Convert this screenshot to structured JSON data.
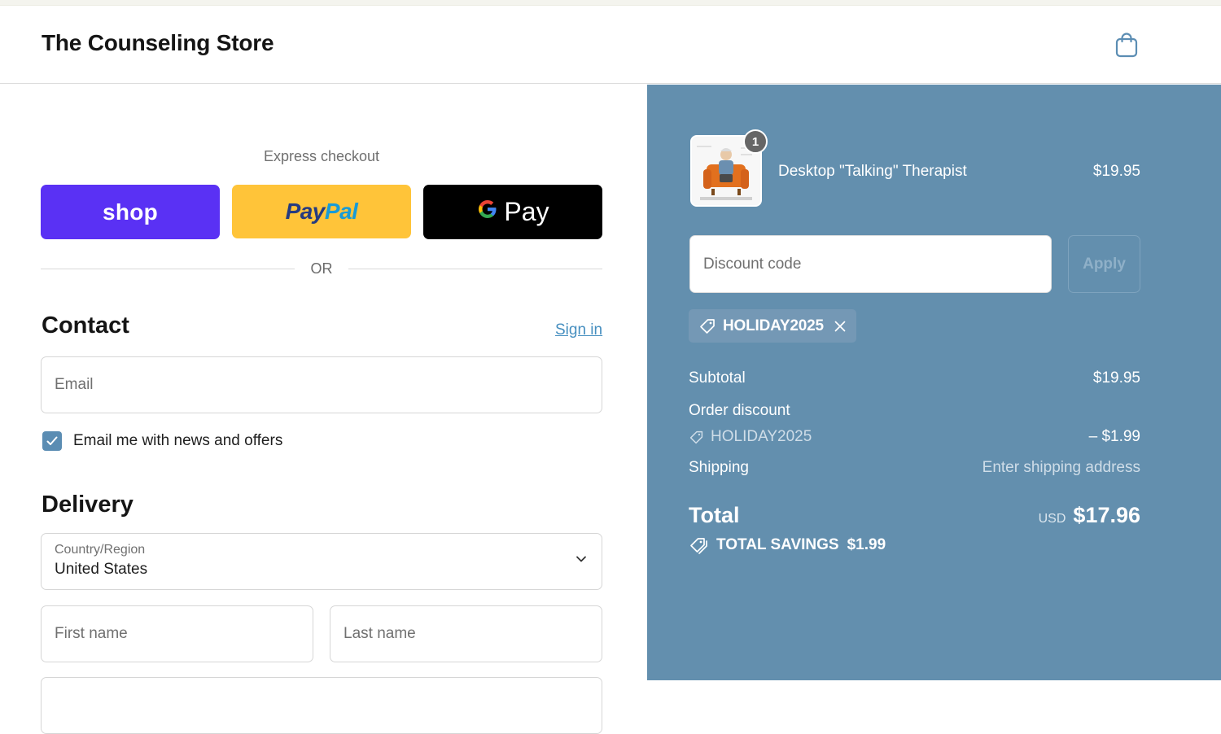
{
  "header": {
    "store_name": "The Counseling Store",
    "cart_icon": "shopping-bag-icon"
  },
  "checkout": {
    "express_label": "Express checkout",
    "express_buttons": {
      "shop": "shop",
      "paypal_part1": "Pay",
      "paypal_part2": "Pal",
      "gpay_g": "G",
      "gpay_word": "Pay"
    },
    "or_label": "OR",
    "contact": {
      "title": "Contact",
      "sign_in": "Sign in",
      "email_placeholder": "Email",
      "newsletter_label": "Email me with news and offers",
      "newsletter_checked": true
    },
    "delivery": {
      "title": "Delivery",
      "country_label": "Country/Region",
      "country_value": "United States",
      "first_name_placeholder": "First name",
      "last_name_placeholder": "Last name"
    }
  },
  "summary": {
    "product": {
      "name": "Desktop \"Talking\" Therapist",
      "price": "$19.95",
      "quantity": "1"
    },
    "discount_placeholder": "Discount code",
    "apply_label": "Apply",
    "applied_code": "HOLIDAY2025",
    "subtotal_label": "Subtotal",
    "subtotal_value": "$19.95",
    "order_discount_label": "Order discount",
    "order_discount_code": "HOLIDAY2025",
    "order_discount_value": "– $1.99",
    "shipping_label": "Shipping",
    "shipping_value": "Enter shipping address",
    "total_label": "Total",
    "currency": "USD",
    "total_value": "$17.96",
    "savings_label": "TOTAL SAVINGS",
    "savings_value": "$1.99"
  },
  "colors": {
    "shop_purple": "#5a31f4",
    "paypal_yellow": "#ffc439",
    "summary_bg": "#638fae",
    "link_blue": "#1773b0"
  }
}
